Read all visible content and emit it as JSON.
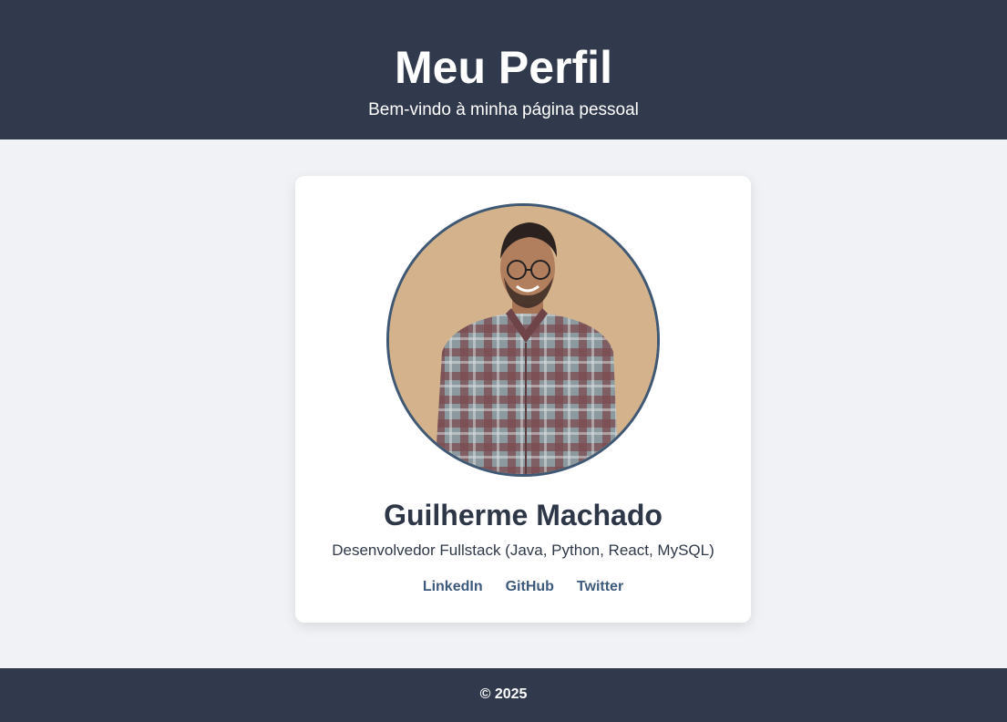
{
  "header": {
    "title": "Meu Perfil",
    "subtitle": "Bem-vindo à minha página pessoal"
  },
  "profile": {
    "name": "Guilherme Machado",
    "role": "Desenvolvedor Fullstack (Java, Python, React, MySQL)",
    "links": [
      {
        "label": "LinkedIn"
      },
      {
        "label": "GitHub"
      },
      {
        "label": "Twitter"
      }
    ]
  },
  "footer": {
    "text": "© 2025"
  },
  "colors": {
    "header_bg": "#313a4c",
    "page_bg": "#f0f2f5",
    "card_bg": "#ffffff",
    "avatar_border": "#3f5874",
    "link": "#3d5a7c"
  }
}
